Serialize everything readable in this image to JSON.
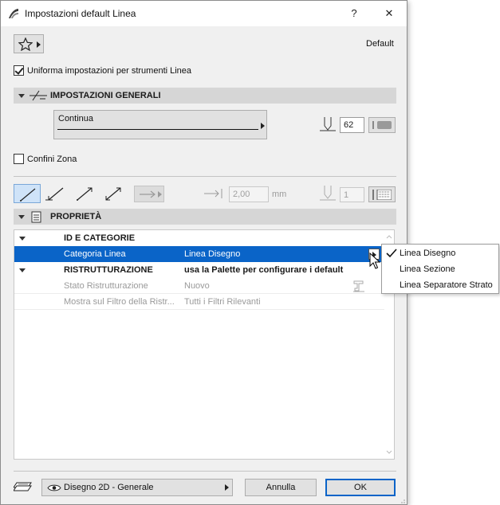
{
  "window": {
    "title": "Impostazioni default Linea",
    "help_label": "?",
    "close_label": "✕"
  },
  "favorites": {
    "star_icon": "star-icon",
    "default_label": "Default"
  },
  "uniform_checkbox": {
    "label": "Uniforma impostazioni per strumenti Linea",
    "checked": true
  },
  "general": {
    "header": "IMPOSTAZIONI GENERALI",
    "line_type": "Continua",
    "pen_value": "62"
  },
  "zone": {
    "label": "Confini Zona",
    "checked": false
  },
  "geometry": {
    "arrow_size_value": "2,00",
    "arrow_unit": "mm",
    "arrow_pen_value": "1"
  },
  "properties": {
    "header": "PROPRIETÀ",
    "rows": [
      {
        "name": "ID E CATEGORIE",
        "value": ""
      },
      {
        "name": "Categoria Linea",
        "value": "Linea Disegno"
      },
      {
        "name": "RISTRUTTURAZIONE",
        "value": "usa la Palette per configurare i default"
      },
      {
        "name": "Stato Ristrutturazione",
        "value": "Nuovo"
      },
      {
        "name": "Mostra sul Filtro della Ristr...",
        "value": "Tutti i Filtri Rilevanti"
      }
    ]
  },
  "dropdown": {
    "items": [
      "Linea Disegno",
      "Linea Sezione",
      "Linea Separatore Strato"
    ],
    "selected": "Linea Disegno"
  },
  "footer": {
    "layer_label": "Disegno 2D - Generale",
    "cancel_label": "Annulla",
    "ok_label": "OK"
  },
  "colors": {
    "selection": "#0a64c8",
    "section_header": "#d6d6d6",
    "dialog_bg": "#f0f0f0"
  }
}
